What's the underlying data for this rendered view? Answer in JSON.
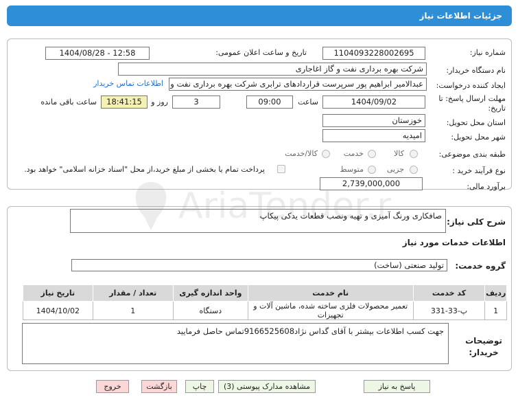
{
  "header": {
    "title": "جزئیات اطلاعات نیاز"
  },
  "form": {
    "need_number_label": "شماره نیاز:",
    "need_number": "1104093228002695",
    "announce_label": "تاریخ و ساعت اعلان عمومی:",
    "announce_value": "1404/08/28 - 12:58",
    "buyer_org_label": "نام دستگاه خریدار:",
    "buyer_org": "شرکت بهره برداری نفت و گاز اغاجاری",
    "creator_label": "ایجاد کننده درخواست:",
    "creator": "عبدالامیر ابراهیم پور سرپرست قراردادهای ترابری شرکت بهره برداری نفت و گاز اغاجاری",
    "contact_link": "اطلاعات تماس خریدار",
    "deadline_label": "مهلت ارسال پاسخ: تا تاریخ:",
    "deadline_date": "1404/09/02",
    "time_label": "ساعت",
    "deadline_time": "09:00",
    "days_value": "3",
    "days_label": "روز و",
    "remaining_time": "18:41:15",
    "remaining_label": "ساعت باقی مانده",
    "province_label": "استان محل تحویل:",
    "province": "خوزستان",
    "city_label": "شهر محل تحویل:",
    "city": "امیدیه",
    "category_label": "طبقه بندی موضوعی:",
    "category_options": [
      "کالا",
      "خدمت",
      "کالا/خدمت"
    ],
    "process_label": "نوع فرآیند خرید :",
    "process_options": [
      "جزیی",
      "متوسط"
    ],
    "payment_note": "پرداخت تمام یا بخشی از مبلغ خرید،از محل \"اسناد خزانه اسلامی\" خواهد بود.",
    "estimate_label": "برآورد مالی:",
    "estimate": "2,739,000,000"
  },
  "description": {
    "label": "شرح کلی نیاز:",
    "text": "صافکاری ورنگ آمیزی و تهیه ونصب قطعات یدکی پیکاپ"
  },
  "services": {
    "section_title": "اطلاعات خدمات مورد نیاز",
    "group_label": "گروه خدمت:",
    "group_value": "تولید صنعتی (ساخت)",
    "columns": [
      "ردیف",
      "کد خدمت",
      "نام خدمت",
      "واحد اندازه گیری",
      "تعداد / مقدار",
      "تاریخ نیاز"
    ],
    "rows": [
      [
        "1",
        "پ-33-331",
        "تعمیر محصولات فلزی ساخته شده، ماشین آلات و تجهیزات",
        "دستگاه",
        "1",
        "1404/10/02"
      ]
    ]
  },
  "buyer_notes": {
    "label": "توضیحات خریدار:",
    "text": "جهت کسب اطلاعات بیشتر با آقای گداس نژاد9166525608تماس حاصل فرمایید"
  },
  "buttons": {
    "reply": "پاسخ به نیاز",
    "attachments": "مشاهده مدارک پیوستی (3)",
    "print": "چاپ",
    "back": "بازگشت",
    "exit": "خروج"
  },
  "watermark": {
    "text": "AriaTender.net"
  }
}
